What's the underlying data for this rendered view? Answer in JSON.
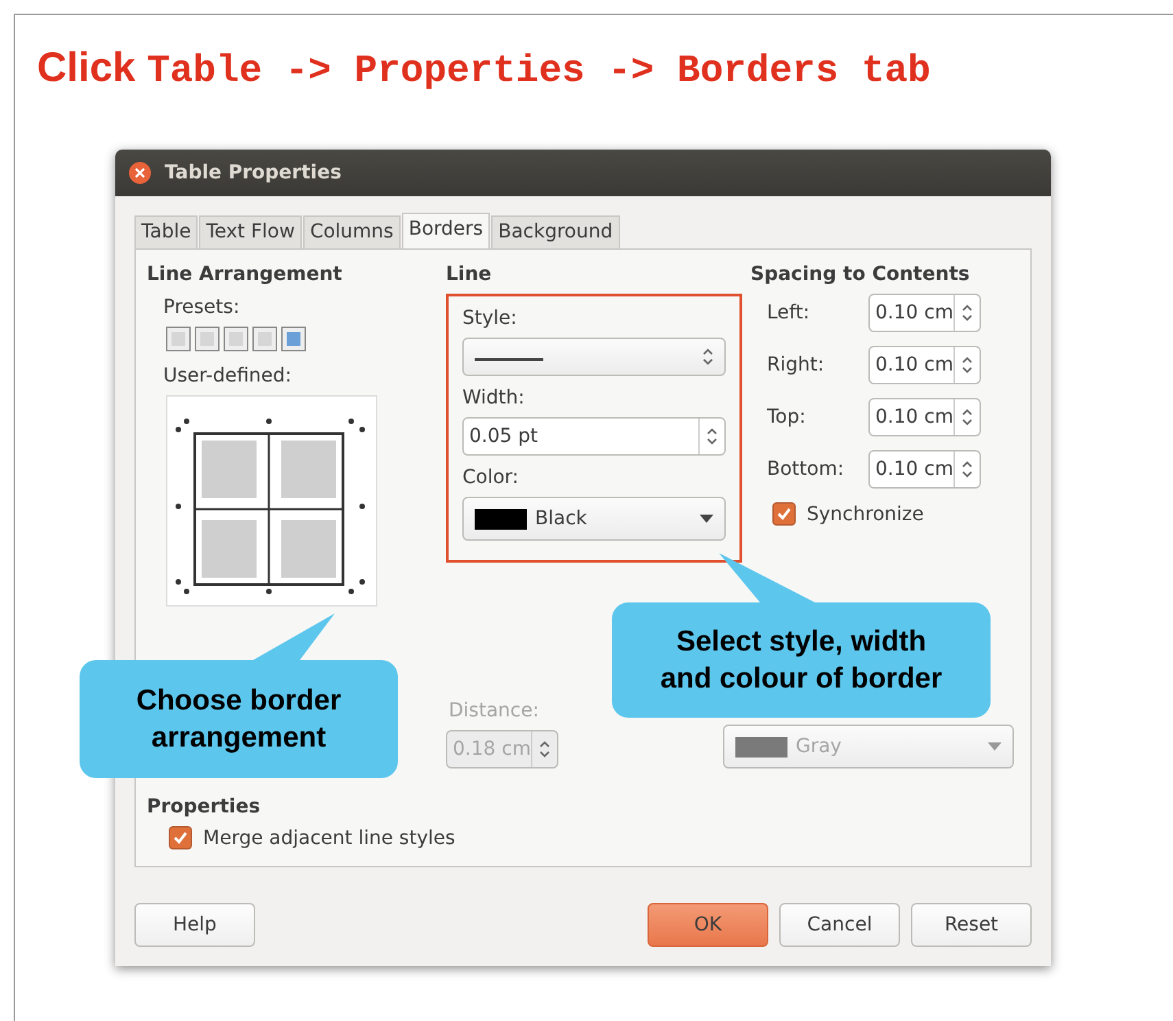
{
  "heading": {
    "prefix": "Click",
    "path": "Table -> Properties -> Borders tab"
  },
  "window": {
    "title": "Table Properties"
  },
  "tabs": [
    {
      "label": "Table",
      "selected": false
    },
    {
      "label": "Text Flow",
      "selected": false
    },
    {
      "label": "Columns",
      "selected": false
    },
    {
      "label": "Borders",
      "selected": true
    },
    {
      "label": "Background",
      "selected": false
    }
  ],
  "line_arrangement": {
    "title": "Line Arrangement",
    "presets_label": "Presets:",
    "presets": [
      {
        "selected": false
      },
      {
        "selected": false
      },
      {
        "selected": false
      },
      {
        "selected": false
      },
      {
        "selected": true
      }
    ],
    "user_defined_label": "User-defined:"
  },
  "line": {
    "title": "Line",
    "style_label": "Style:",
    "width_label": "Width:",
    "width_value": "0.05 pt",
    "color_label": "Color:",
    "color_name": "Black",
    "color": "#000000"
  },
  "spacing": {
    "title": "Spacing to Contents",
    "fields": [
      {
        "label": "Left:",
        "value": "0.10 cm"
      },
      {
        "label": "Right:",
        "value": "0.10 cm"
      },
      {
        "label": "Top:",
        "value": "0.10 cm"
      },
      {
        "label": "Bottom:",
        "value": "0.10 cm"
      }
    ],
    "synchronize": {
      "label": "Synchronize",
      "checked": true
    }
  },
  "shadow": {
    "distance_label": "Distance:",
    "distance_value": "0.18 cm",
    "color_name": "Gray",
    "color": "#7a7a7a",
    "disabled": true
  },
  "properties": {
    "title": "Properties",
    "merge": {
      "label": "Merge adjacent line styles",
      "checked": true
    }
  },
  "buttons": [
    {
      "label": "Help",
      "kind": "plain"
    },
    {
      "label": "OK",
      "kind": "default"
    },
    {
      "label": "Cancel",
      "kind": "plain"
    },
    {
      "label": "Reset",
      "kind": "plain"
    }
  ],
  "callouts": [
    {
      "text": "Choose border arrangement"
    },
    {
      "text": "Select style, width and colour of border"
    }
  ]
}
